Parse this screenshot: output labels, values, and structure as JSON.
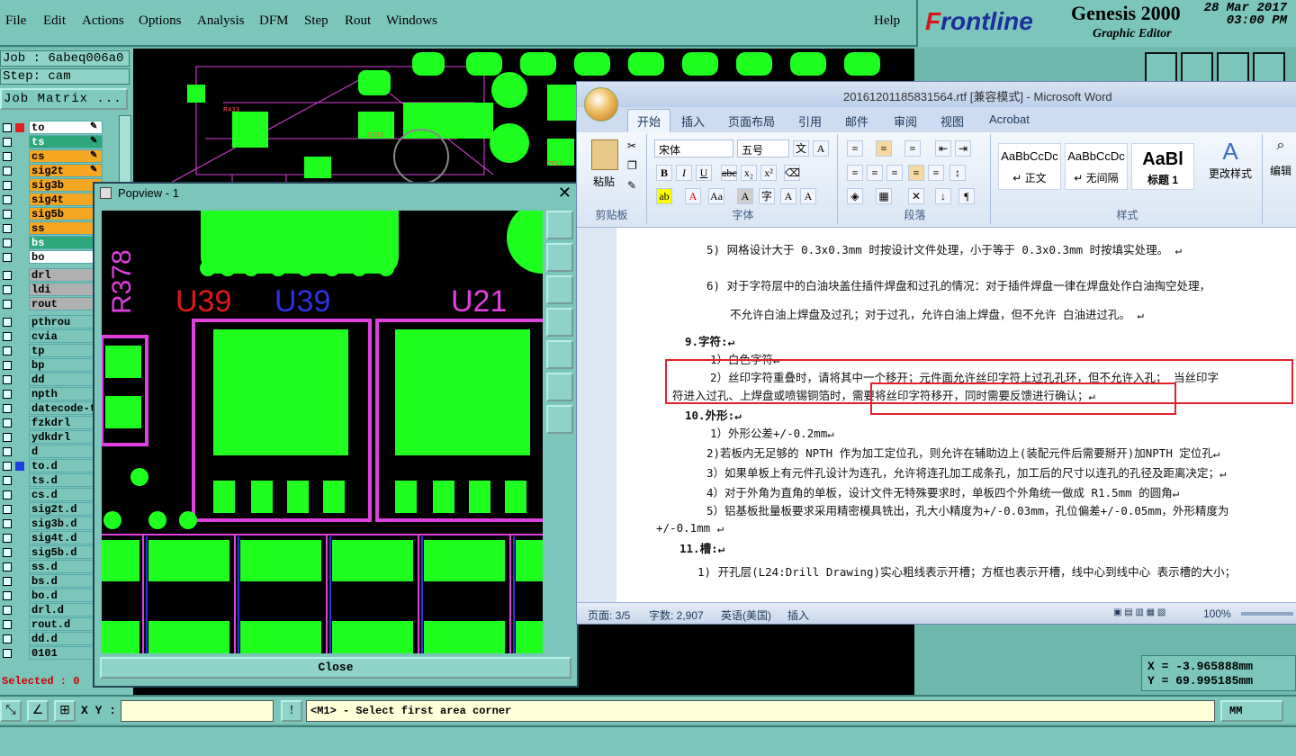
{
  "menu": {
    "file": "File",
    "edit": "Edit",
    "actions": "Actions",
    "options": "Options",
    "analysis": "Analysis",
    "dfm": "DFM",
    "step": "Step",
    "rout": "Rout",
    "windows": "Windows",
    "help": "Help"
  },
  "brand": {
    "logo_f": "F",
    "logo_rest": "rontline",
    "product": "Genesis 2000",
    "subtitle": "Graphic Editor",
    "date": "28 Mar 2017",
    "time": "03:00 PM"
  },
  "job": {
    "job": "Job : 6abeq006a0",
    "step": "Step: cam",
    "matrix_button": "Job Matrix ..."
  },
  "layers": [
    {
      "name": "to",
      "color": "#ffffff",
      "mark": "#e02020",
      "icon": "✎"
    },
    {
      "name": "ts",
      "color": "#2fa77d",
      "mark": "",
      "icon": "✎"
    },
    {
      "name": "cs",
      "color": "#f5a623",
      "mark": "",
      "icon": "✎"
    },
    {
      "name": "sig2t",
      "color": "#f5a623",
      "mark": "",
      "icon": "✎"
    },
    {
      "name": "sig3b",
      "color": "#f5a623",
      "mark": "",
      "icon": ""
    },
    {
      "name": "sig4t",
      "color": "#f5a623",
      "mark": "",
      "icon": ""
    },
    {
      "name": "sig5b",
      "color": "#f5a623",
      "mark": "",
      "icon": ""
    },
    {
      "name": "ss",
      "color": "#f5a623",
      "mark": "",
      "icon": ""
    },
    {
      "name": "bs",
      "color": "#2fa77d",
      "mark": "",
      "icon": ""
    },
    {
      "name": "bo",
      "color": "#ffffff",
      "mark": "",
      "icon": ""
    },
    {
      "name": "drl",
      "color": "#b0b0b0",
      "mark": "",
      "icon": ""
    },
    {
      "name": "ldi",
      "color": "#b0b0b0",
      "mark": "",
      "icon": ""
    },
    {
      "name": "rout",
      "color": "#b0b0b0",
      "mark": "",
      "icon": ""
    },
    {
      "name": "pthrou",
      "color": "#7cc5bb",
      "mark": "",
      "icon": ""
    },
    {
      "name": "cvia",
      "color": "#7cc5bb",
      "mark": "",
      "icon": ""
    },
    {
      "name": "tp",
      "color": "#7cc5bb",
      "mark": "",
      "icon": ""
    },
    {
      "name": "bp",
      "color": "#7cc5bb",
      "mark": "",
      "icon": ""
    },
    {
      "name": "dd",
      "color": "#7cc5bb",
      "mark": "",
      "icon": ""
    },
    {
      "name": "npth",
      "color": "#7cc5bb",
      "mark": "",
      "icon": ""
    },
    {
      "name": "datecode-t",
      "color": "#7cc5bb",
      "mark": "",
      "icon": ""
    },
    {
      "name": "fzkdrl",
      "color": "#7cc5bb",
      "mark": "",
      "icon": ""
    },
    {
      "name": "ydkdrl",
      "color": "#7cc5bb",
      "mark": "",
      "icon": ""
    },
    {
      "name": "d",
      "color": "#7cc5bb",
      "mark": "",
      "icon": ""
    },
    {
      "name": "to.d",
      "color": "#7cc5bb",
      "mark": "#2040e0",
      "icon": ""
    },
    {
      "name": "ts.d",
      "color": "#7cc5bb",
      "mark": "",
      "icon": ""
    },
    {
      "name": "cs.d",
      "color": "#7cc5bb",
      "mark": "",
      "icon": ""
    },
    {
      "name": "sig2t.d",
      "color": "#7cc5bb",
      "mark": "",
      "icon": ""
    },
    {
      "name": "sig3b.d",
      "color": "#7cc5bb",
      "mark": "",
      "icon": ""
    },
    {
      "name": "sig4t.d",
      "color": "#7cc5bb",
      "mark": "",
      "icon": ""
    },
    {
      "name": "sig5b.d",
      "color": "#7cc5bb",
      "mark": "",
      "icon": ""
    },
    {
      "name": "ss.d",
      "color": "#7cc5bb",
      "mark": "",
      "icon": ""
    },
    {
      "name": "bs.d",
      "color": "#7cc5bb",
      "mark": "",
      "icon": ""
    },
    {
      "name": "bo.d",
      "color": "#7cc5bb",
      "mark": "",
      "icon": ""
    },
    {
      "name": "drl.d",
      "color": "#7cc5bb",
      "mark": "",
      "icon": ""
    },
    {
      "name": "rout.d",
      "color": "#7cc5bb",
      "mark": "",
      "icon": ""
    },
    {
      "name": "dd.d",
      "color": "#7cc5bb",
      "mark": "",
      "icon": ""
    },
    {
      "name": "0101",
      "color": "#7cc5bb",
      "mark": "",
      "icon": ""
    }
  ],
  "selected": "Selected : 0",
  "status": {
    "xy_label": "X Y :",
    "xy_value": "",
    "message": "<M1> - Select first area corner",
    "units": "MM"
  },
  "coords": {
    "x": "X  = -3.965888mm",
    "y": "Y  = 69.995185mm"
  },
  "popview": {
    "title": "Popview - 1",
    "close_button": "Close",
    "labels": {
      "r378": "R378",
      "u39a": "U39",
      "u39b": "U39",
      "u21": "U21"
    }
  },
  "word": {
    "title": "20161201185831564.rtf [兼容模式] - Microsoft Word",
    "tabs": [
      "开始",
      "插入",
      "页面布局",
      "引用",
      "邮件",
      "审阅",
      "视图",
      "Acrobat"
    ],
    "ribbon": {
      "paste": "粘贴",
      "clipboard": "剪贴板",
      "font_name": "宋体",
      "font_size": "五号",
      "font_group": "字体",
      "para_group": "段落",
      "styles_group": "样式",
      "edit_group": "编辑",
      "change_styles": "更改样式",
      "edit": "编辑",
      "styles": [
        {
          "preview": "AaBbCcDc",
          "name": "↵ 正文"
        },
        {
          "preview": "AaBbCcDc",
          "name": "↵ 无间隔"
        },
        {
          "preview": "AaBl",
          "name": "标题 1"
        }
      ]
    },
    "doc_lines": [
      "5)  网格设计大于 0.3x0.3mm 时按设计文件处理，小于等于 0.3x0.3mm 时按填实处理。 ↵",
      "6)  对于字符层中的白油块盖住插件焊盘和过孔的情况：对于插件焊盘一律在焊盘处作白油掏空处理，",
      "不允许白油上焊盘及过孔；对于过孔，允许白油上焊盘，但不允许 白油进过孔。 ↵",
      "9.字符:↵",
      "1）白色字符↵",
      "2）丝印字符重叠时，请将其中一个移开；元件面允许丝印字符上过孔孔环，但不允许入孔； 当丝印字",
      "符进入过孔、上焊盘或喷锡铜箔时，需要将丝印字符移开，同时需要反馈进行确认；↵",
      "10.外形:↵",
      "1）外形公差+/-0.2mm↵",
      "2)若板内无足够的 NPTH 作为加工定位孔，则允许在辅助边上(装配元件后需要掰开)加NPTH 定位孔↵",
      "3）如果单板上有元件孔设计为连孔，允许将连孔加工成条孔，加工后的尺寸以连孔的孔径及距离决定；↵",
      "4）对于外角为直角的单板，设计文件无特殊要求时，单板四个外角统一做成 R1.5mm 的圆角↵",
      "5）铝基板批量板要求采用精密模具铣出，孔大小精度为+/-0.03mm，孔位偏差+/-0.05mm，外形精度为",
      "+/-0.1mm ↵",
      "11.槽:↵",
      "1)  开孔层(L24:Drill Drawing)实心粗线表示开槽；方框也表示开槽，线中心到线中心 表示槽的大小；"
    ],
    "statusbar": {
      "page": "页面: 3/5",
      "words": "字数: 2,907",
      "lang": "英语(美国)",
      "mode": "插入",
      "zoom": "100%"
    }
  }
}
